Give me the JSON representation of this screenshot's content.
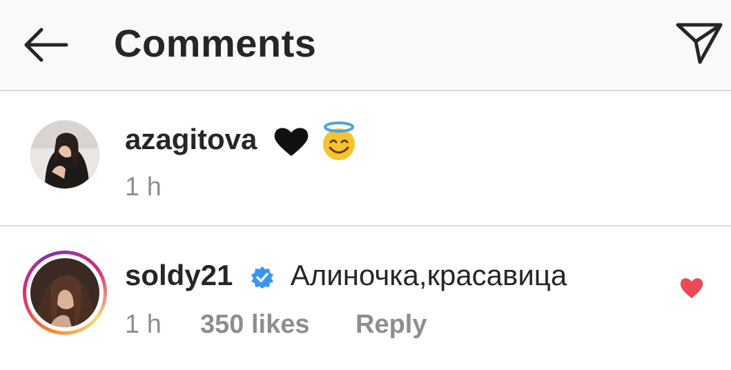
{
  "header": {
    "title": "Comments",
    "back_icon": "arrow-left-icon",
    "send_icon": "paper-plane-icon"
  },
  "caption": {
    "username": "azagitova",
    "emojis": [
      "black-heart-emoji",
      "smiling-face-with-halo-emoji"
    ],
    "time": "1 h"
  },
  "comments": [
    {
      "username": "soldy21",
      "verified": true,
      "text": "Алиночка,красавица",
      "time": "1 h",
      "likes": "350 likes",
      "reply_label": "Reply",
      "liked": true
    }
  ],
  "colors": {
    "text": "#262626",
    "meta": "#8e8e8e",
    "verified_blue": "#3897f0",
    "like_red": "#ed4956",
    "header_bg": "#f9f9f9",
    "divider": "#dcdcdc"
  }
}
